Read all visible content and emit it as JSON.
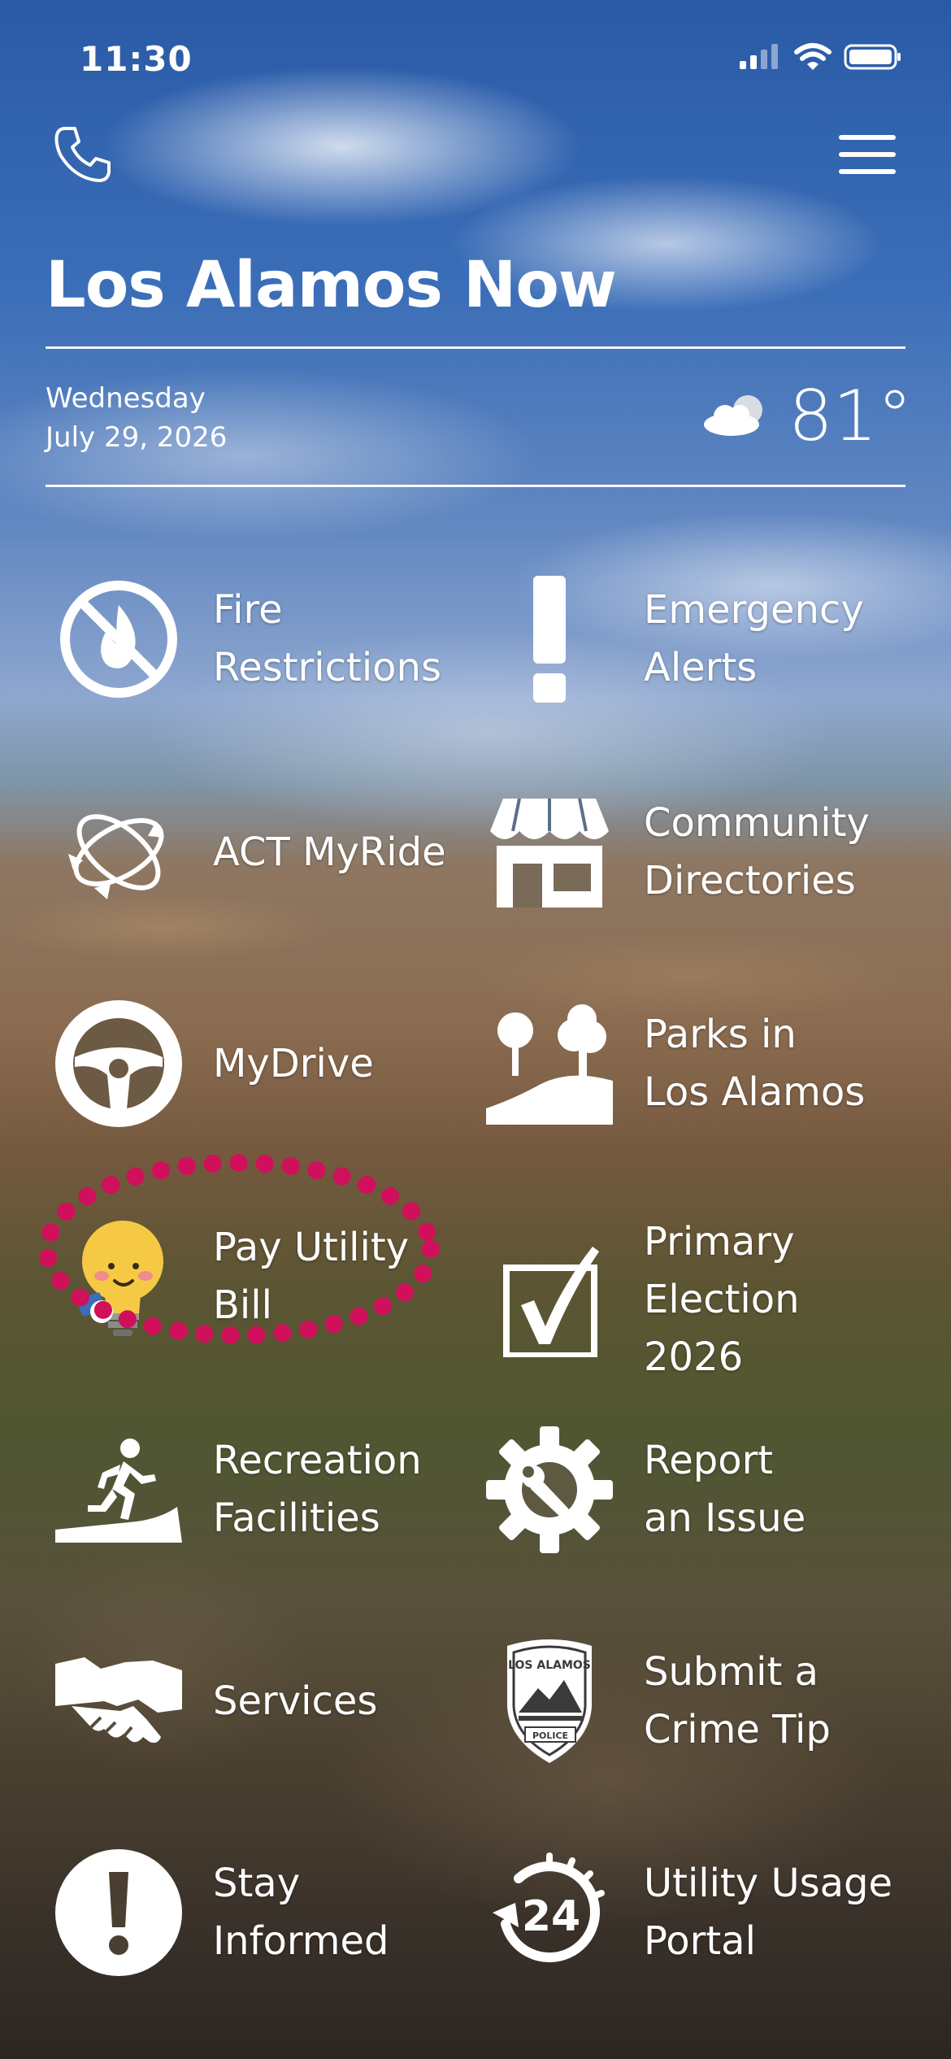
{
  "status_bar": {
    "time": "11:30"
  },
  "header": {
    "title": "Los Alamos Now",
    "day": "Wednesday",
    "date": "July 29, 2026",
    "temperature": "81°",
    "weather_icon": "partly-cloudy-night-icon"
  },
  "tiles": [
    {
      "label": "Fire\nRestrictions",
      "icon": "no-fire-icon"
    },
    {
      "label": "Emergency\nAlerts",
      "icon": "exclamation-icon"
    },
    {
      "label": "ACT MyRide",
      "icon": "bus-route-arrows-icon"
    },
    {
      "label": "Community\nDirectories",
      "icon": "storefront-icon"
    },
    {
      "label": "MyDrive",
      "icon": "steering-wheel-icon"
    },
    {
      "label": "Parks in\nLos Alamos",
      "icon": "park-trees-icon"
    },
    {
      "label": "Pay Utility\nBill",
      "icon": "lightbulb-character-icon"
    },
    {
      "label": "Primary\nElection\n2026",
      "icon": "ballot-checkbox-icon"
    },
    {
      "label": "Recreation\nFacilities",
      "icon": "runner-icon"
    },
    {
      "label": "Report\nan Issue",
      "icon": "gear-wrench-icon"
    },
    {
      "label": "Services",
      "icon": "handshake-icon"
    },
    {
      "label": "Submit a\nCrime Tip",
      "icon": "police-badge-icon"
    },
    {
      "label": "Stay\nInformed",
      "icon": "info-exclamation-circle-icon"
    },
    {
      "label": "Utility Usage\nPortal",
      "icon": "24-hour-icon"
    }
  ],
  "badge_text": {
    "top": "LOS ALAMOS",
    "bottom": "POLICE"
  },
  "clock_text": "24",
  "colors": {
    "highlight_dots": "#d0105a",
    "text": "#ffffff"
  }
}
